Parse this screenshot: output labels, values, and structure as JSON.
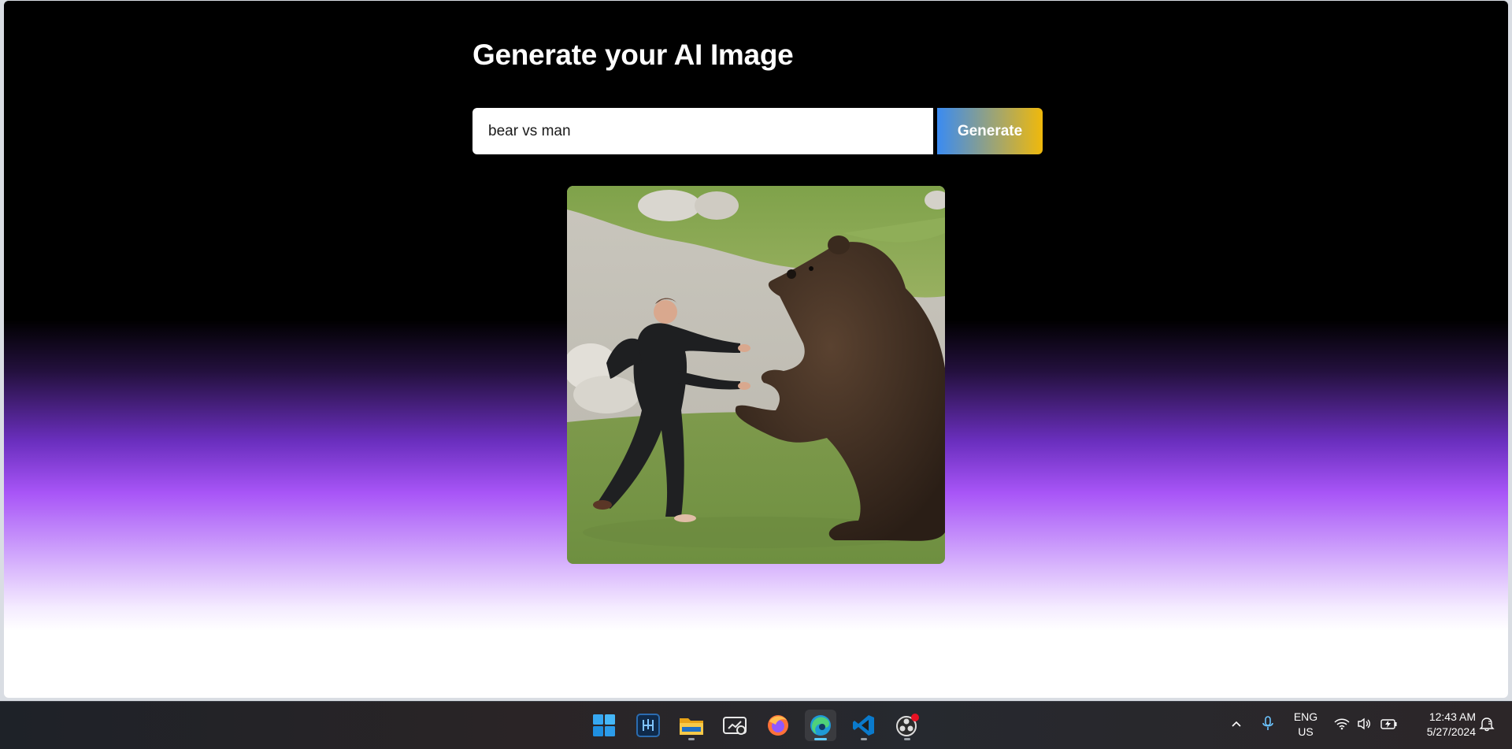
{
  "page": {
    "title": "Generate your AI Image",
    "prompt_value": "bear vs man",
    "generate_label": "Generate"
  },
  "colors": {
    "background_top": "#000000",
    "gradient_mid": "#a855f7",
    "background_bottom": "#ffffff",
    "button_gradient_start": "#3a8bf2",
    "button_gradient_end": "#f0b90b"
  },
  "taskbar": {
    "apps": [
      {
        "name": "start-icon"
      },
      {
        "name": "app-icon"
      },
      {
        "name": "file-explorer-icon"
      },
      {
        "name": "dev-home-icon"
      },
      {
        "name": "firefox-icon"
      },
      {
        "name": "edge-icon",
        "active": true
      },
      {
        "name": "vscode-icon"
      },
      {
        "name": "obs-icon"
      }
    ],
    "tray": {
      "language_line1": "ENG",
      "language_line2": "US",
      "time": "12:43 AM",
      "date": "5/27/2024"
    }
  }
}
